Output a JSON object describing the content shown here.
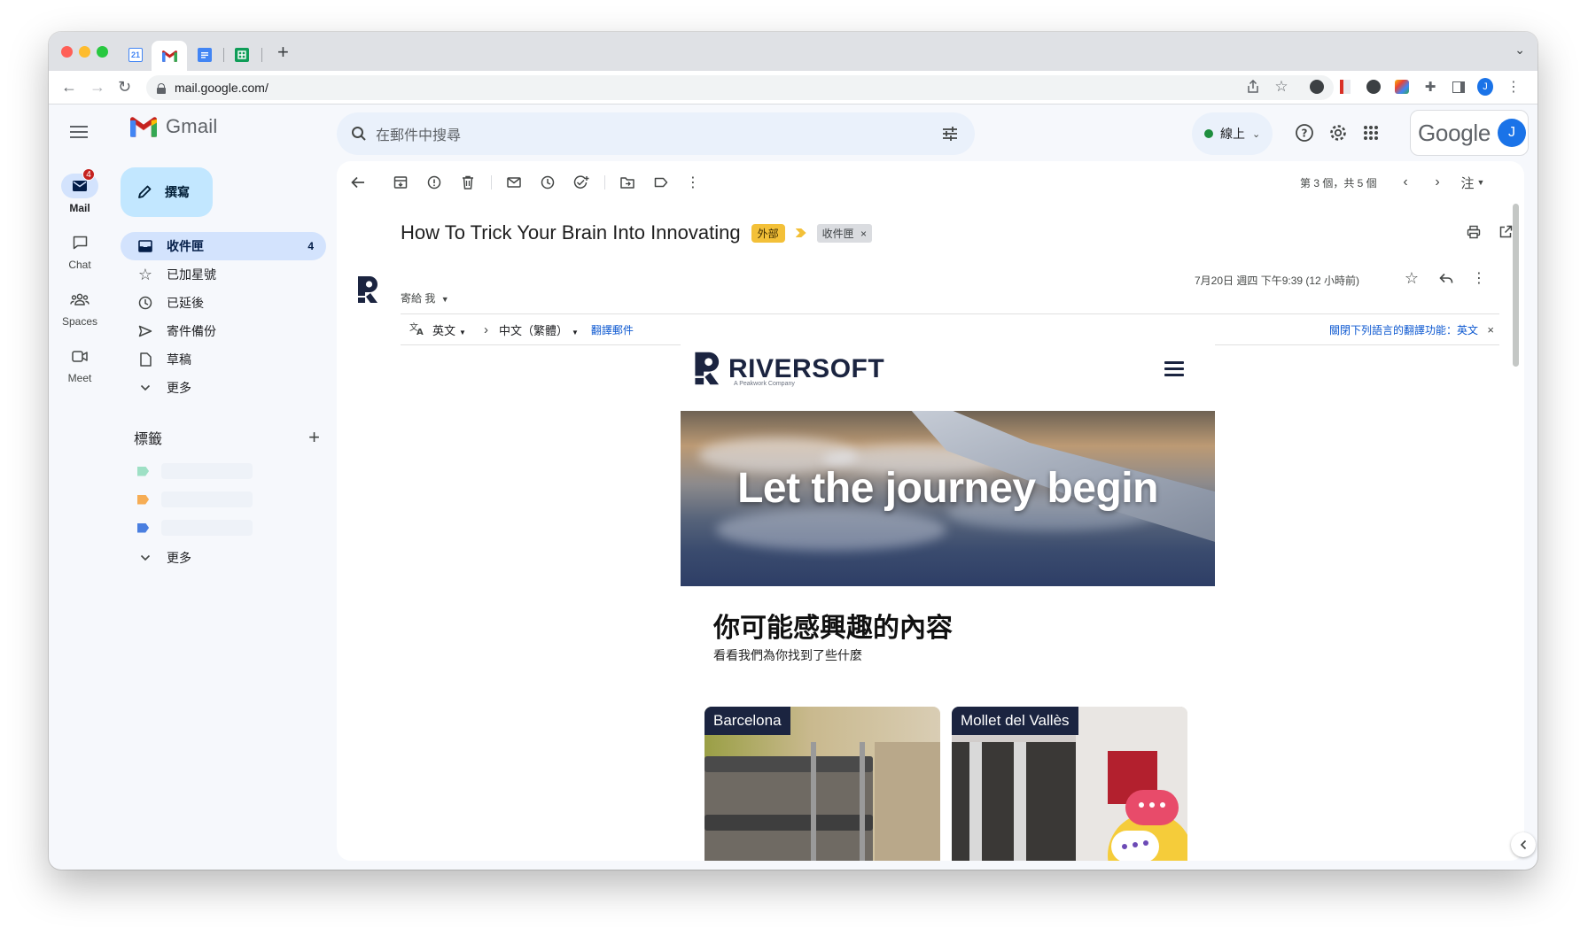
{
  "browser": {
    "url": "mail.google.com/",
    "tabs": [
      {
        "icon": "calendar-favicon",
        "color": "#4285f4",
        "text": "21"
      },
      {
        "icon": "gmail-favicon",
        "color": "#ea4335",
        "text": "M",
        "active": true
      },
      {
        "icon": "docs-favicon",
        "color": "#4285f4",
        "text": ""
      },
      {
        "icon": "sheets-favicon",
        "color": "#0f9d58",
        "text": ""
      }
    ],
    "new_tab": "+",
    "profile_initial": "J"
  },
  "gmail": {
    "product_name": "Gmail",
    "search_placeholder": "在郵件中搜尋",
    "status": "線上",
    "google_word": "Google",
    "avatar_initial": "J"
  },
  "rail": [
    {
      "label": "Mail",
      "icon": "mail-icon",
      "badge": "4",
      "active": true
    },
    {
      "label": "Chat",
      "icon": "chat-icon"
    },
    {
      "label": "Spaces",
      "icon": "spaces-icon"
    },
    {
      "label": "Meet",
      "icon": "meet-icon"
    }
  ],
  "sidebar": {
    "compose_label": "撰寫",
    "items": [
      {
        "label": "收件匣",
        "icon": "inbox-icon",
        "count": "4",
        "active": true
      },
      {
        "label": "已加星號",
        "icon": "star-icon"
      },
      {
        "label": "已延後",
        "icon": "clock-icon"
      },
      {
        "label": "寄件備份",
        "icon": "send-icon"
      },
      {
        "label": "草稿",
        "icon": "draft-icon"
      },
      {
        "label": "更多",
        "icon": "chevron-down-icon"
      }
    ],
    "labels_heading": "標籤",
    "labels": [
      {
        "color": "#9ee0c5"
      },
      {
        "color": "#f6ad55"
      },
      {
        "color": "#4a7fe0"
      }
    ],
    "labels_more": "更多"
  },
  "message": {
    "paging": "第 3 個，共 5 個",
    "input_tool": "注",
    "subject": "How To Trick Your Brain Into Innovating",
    "tag_external": "外部",
    "tag_inbox": "收件匣",
    "tag_inbox_close": "×",
    "sent_to": "寄給 我",
    "date": "7月20日 週四 下午9:39 (12 小時前)",
    "translate": {
      "from_lang": "英文",
      "to_lang": "中文（繁體）",
      "translate_link": "翻譯郵件",
      "disable_link": "關閉下列語言的翻譯功能：英文",
      "close": "×"
    }
  },
  "email_body": {
    "brand": "RIVERSOFT",
    "brand_sub": "A Peakwork Company",
    "hero_text": "Let the journey begin",
    "rec_title": "你可能感興趣的內容",
    "rec_sub": "看看我們為你找到了些什麼",
    "cards": [
      {
        "city": "Barcelona"
      },
      {
        "city": "Mollet del Vallès"
      }
    ]
  }
}
